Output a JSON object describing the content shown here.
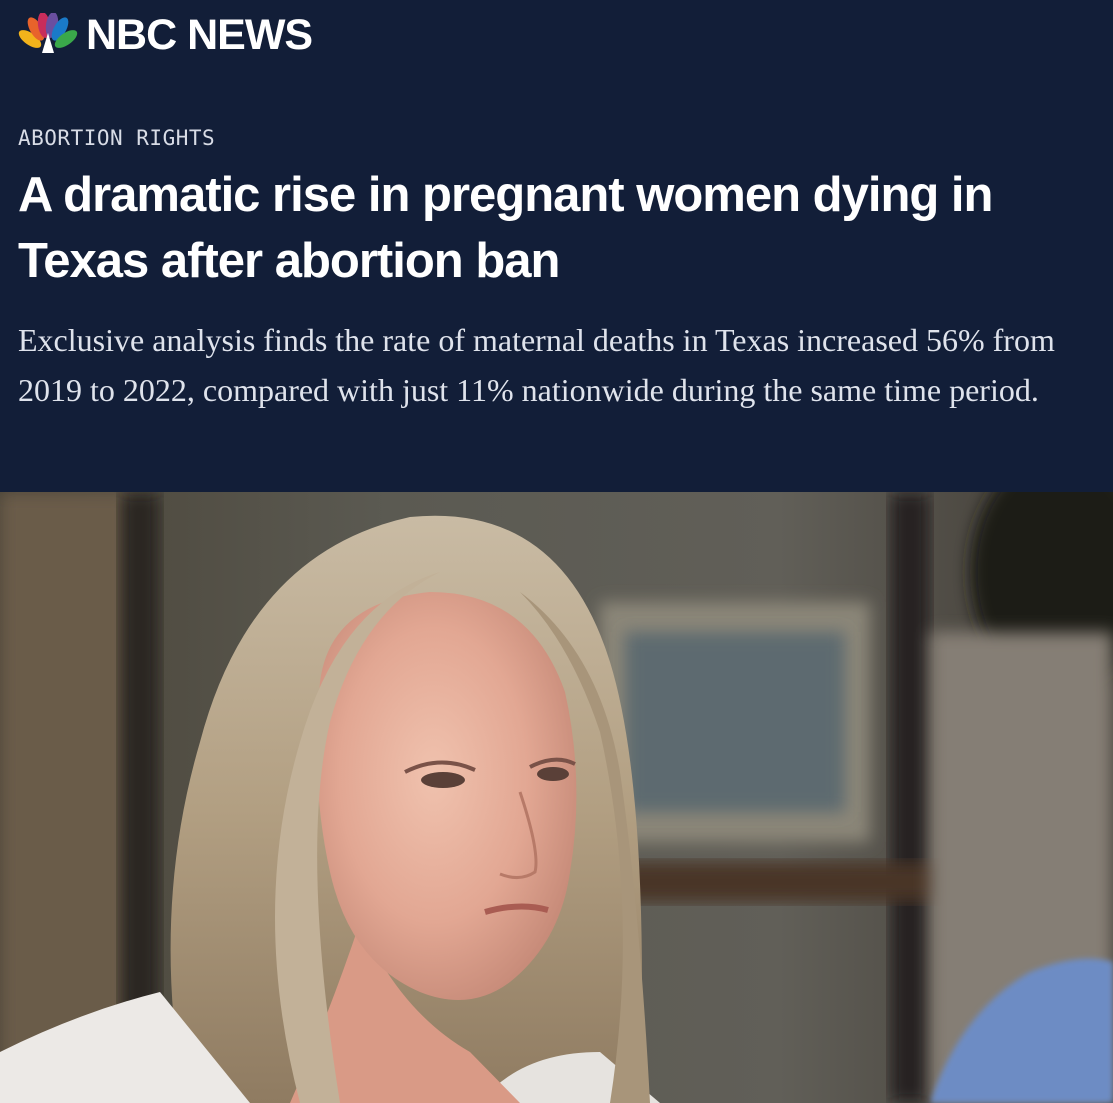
{
  "brand": {
    "name": "NBC NEWS",
    "logo_icon": "peacock-icon",
    "colors": {
      "background": "#121e38",
      "text": "#ffffff"
    }
  },
  "article": {
    "section": "ABORTION RIGHTS",
    "headline": "A dramatic rise in pregnant women dying in Texas after abortion ban",
    "dek": "Exclusive analysis finds the rate of maternal deaths in Texas increased 56% from 2019 to 2022, compared with just 11% nationwide during the same time period."
  }
}
